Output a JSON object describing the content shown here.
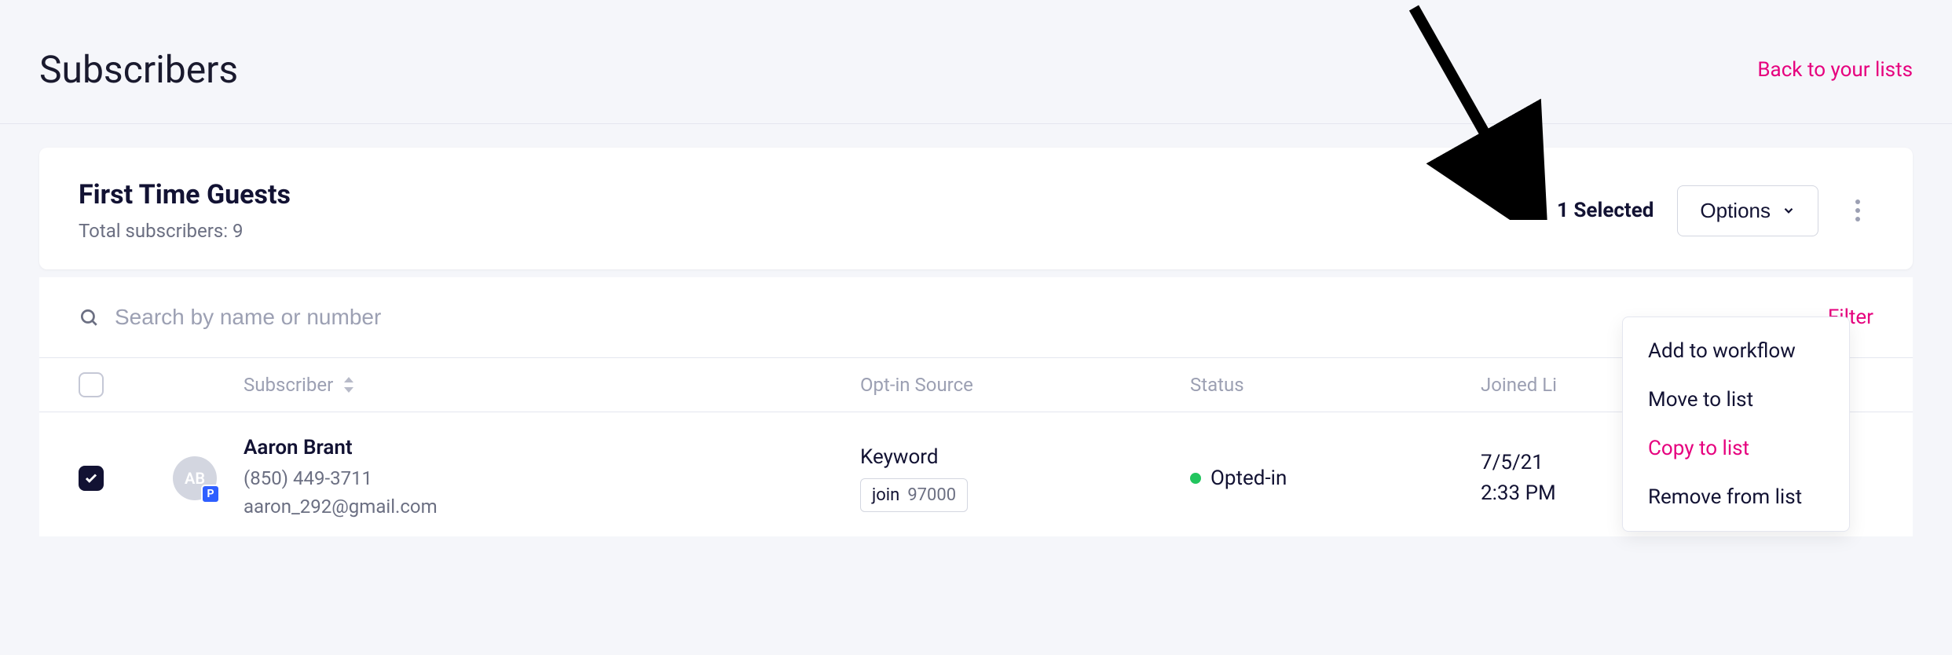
{
  "header": {
    "title": "Subscribers",
    "back_link": "Back to your lists"
  },
  "list": {
    "name": "First Time Guests",
    "subscriber_count_label": "Total subscribers: 9",
    "selected_label": "1 Selected",
    "options_label": "Options"
  },
  "dropdown": {
    "items": [
      {
        "label": "Add to workflow"
      },
      {
        "label": "Move to list"
      },
      {
        "label": "Copy to list",
        "accent": true
      },
      {
        "label": "Remove from list"
      }
    ]
  },
  "search": {
    "placeholder": "Search by name or number",
    "filter_label": "Filter"
  },
  "columns": {
    "subscriber": "Subscriber",
    "optin_source": "Opt-in Source",
    "status": "Status",
    "joined": "Joined Li"
  },
  "rows": [
    {
      "initials": "AB",
      "badge": "P",
      "name": "Aaron Brant",
      "phone": "(850) 449-3711",
      "email": "aaron_292@gmail.com",
      "optin_source": "Keyword",
      "keyword": "join",
      "keyword_code": "97000",
      "status": "Opted-in",
      "joined_date": "7/5/21",
      "joined_time": "2:33 PM",
      "checked": true
    }
  ]
}
